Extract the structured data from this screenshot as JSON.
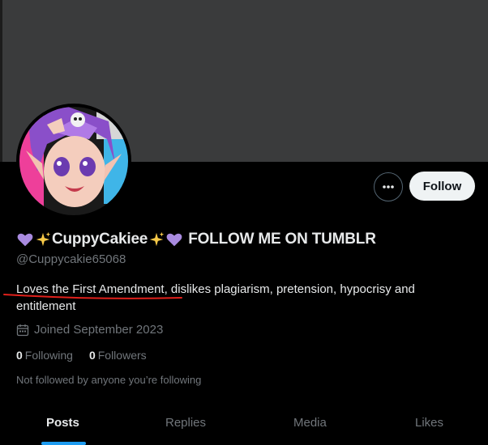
{
  "profile": {
    "display_name": "CuppyCakiee",
    "name_suffix": "FOLLOW ME ON TUMBLR",
    "handle": "@Cuppycakie65068",
    "bio": "Loves the First Amendment, dislikes plagiarism, pretension, hypocrisy and entitlement",
    "joined": "Joined September 2023",
    "following_count": "0",
    "following_label": "Following",
    "followers_count": "0",
    "followers_label": "Followers",
    "not_followed_text": "Not followed by anyone you’re following"
  },
  "actions": {
    "follow_label": "Follow"
  },
  "tabs": [
    {
      "label": "Posts",
      "active": true
    },
    {
      "label": "Replies",
      "active": false
    },
    {
      "label": "Media",
      "active": false
    },
    {
      "label": "Likes",
      "active": false
    }
  ],
  "colors": {
    "background": "#000000",
    "banner": "#3a3b3c",
    "accent": "#1d9bf0",
    "annotation": "#e0201b",
    "heart": "#a98be0"
  },
  "icons": [
    "purple-heart-icon",
    "sparkles-icon",
    "more-dots-icon",
    "calendar-icon"
  ]
}
